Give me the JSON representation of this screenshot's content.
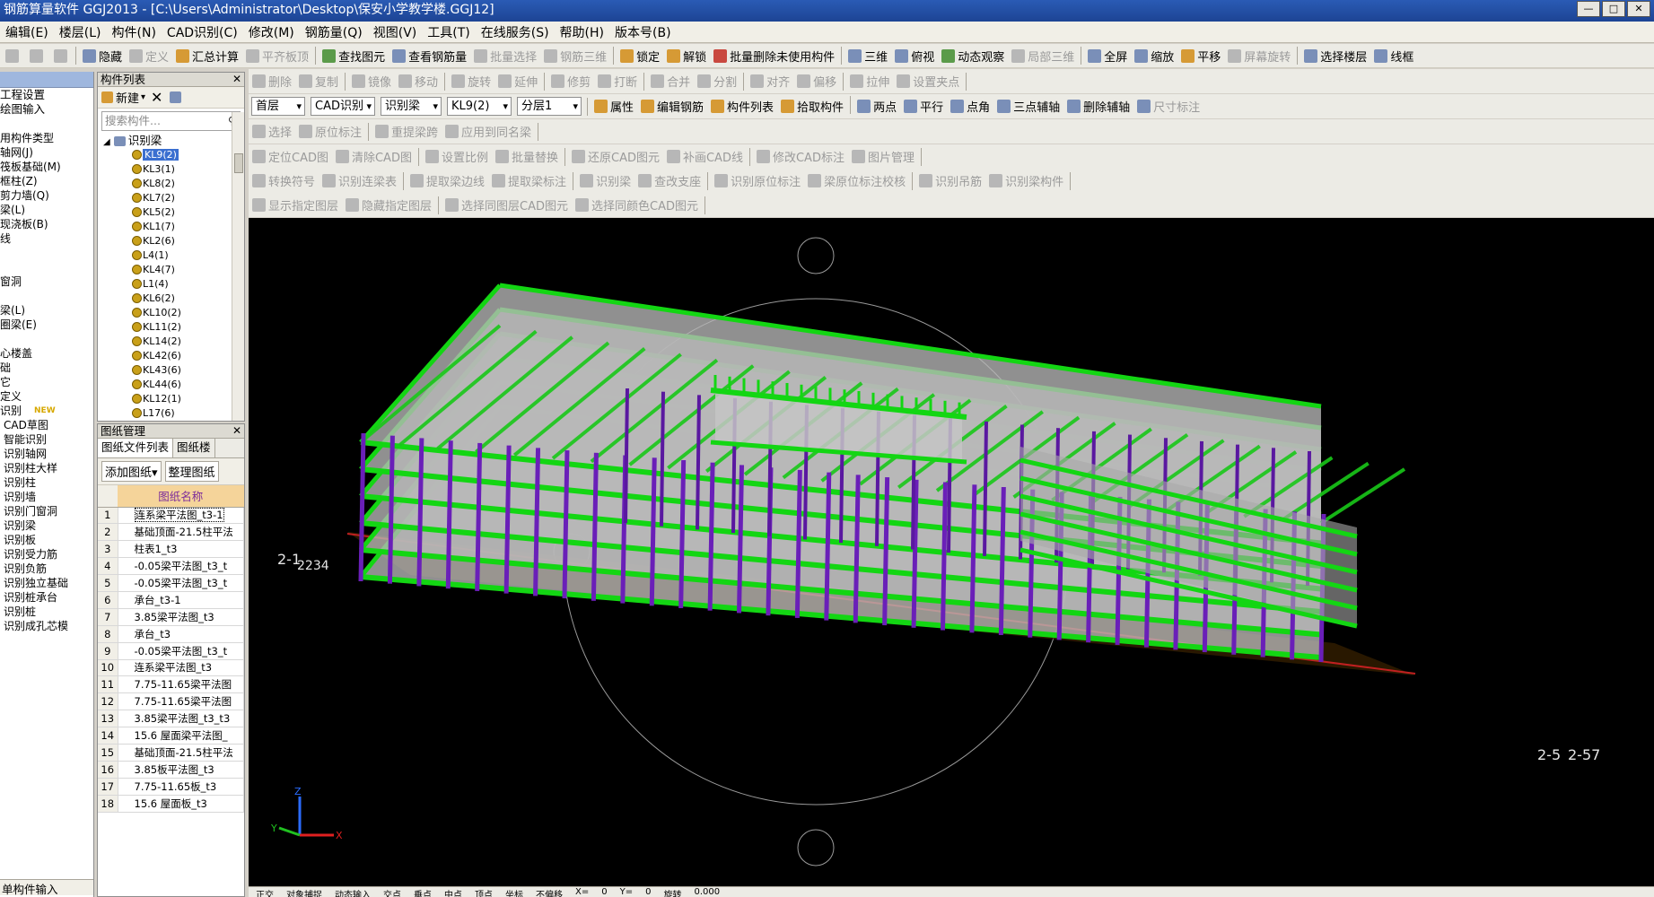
{
  "window": {
    "title": "钢筋算量软件 GGJ2013 - [C:\\Users\\Administrator\\Desktop\\保安小学教学楼.GGJ12]",
    "buttons": [
      "—",
      "□",
      "✕"
    ]
  },
  "menu": [
    "编辑(E)",
    "楼层(L)",
    "构件(N)",
    "CAD识别(C)",
    "修改(M)",
    "钢筋量(Q)",
    "视图(V)",
    "工具(T)",
    "在线服务(S)",
    "帮助(H)",
    "版本号(B)"
  ],
  "toolbar1": {
    "items": [
      {
        "label": "隐藏",
        "disabled": false
      },
      {
        "label": "定义",
        "disabled": true
      },
      {
        "label": "汇总计算",
        "disabled": false
      },
      {
        "label": "平齐板顶",
        "disabled": true
      },
      {
        "label": "查找图元",
        "disabled": false
      },
      {
        "label": "查看钢筋量",
        "disabled": false
      },
      {
        "label": "批量选择",
        "disabled": true
      },
      {
        "label": "钢筋三维",
        "disabled": true
      },
      {
        "label": "锁定",
        "disabled": false
      },
      {
        "label": "解锁",
        "disabled": false
      },
      {
        "label": "批量删除未使用构件",
        "disabled": false
      },
      {
        "label": "三维",
        "disabled": false
      },
      {
        "label": "俯视",
        "disabled": false
      },
      {
        "label": "动态观察",
        "disabled": false
      },
      {
        "label": "局部三维",
        "disabled": true
      },
      {
        "label": "全屏",
        "disabled": false
      },
      {
        "label": "缩放",
        "disabled": false
      },
      {
        "label": "平移",
        "disabled": false
      },
      {
        "label": "屏幕旋转",
        "disabled": true
      },
      {
        "label": "选择楼层",
        "disabled": false
      },
      {
        "label": "线框",
        "disabled": false
      }
    ]
  },
  "toolbar2": {
    "items": [
      "删除",
      "复制",
      "镜像",
      "移动",
      "旋转",
      "延伸",
      "修剪",
      "打断",
      "合并",
      "分割",
      "对齐",
      "偏移",
      "拉伸",
      "设置夹点"
    ]
  },
  "toolbar3": {
    "floor": "首层",
    "mode": "CAD识别",
    "type": "识别梁",
    "comp": "KL9(2)",
    "layer": "分层1",
    "items": [
      "属性",
      "编辑钢筋",
      "构件列表",
      "拾取构件",
      "两点",
      "平行",
      "点角",
      "三点辅轴",
      "删除辅轴",
      "尺寸标注"
    ]
  },
  "toolbar4": {
    "items": [
      "选择",
      "原位标注",
      "重提梁跨",
      "应用到同名梁"
    ]
  },
  "toolbar5": {
    "items": [
      "定位CAD图",
      "清除CAD图",
      "设置比例",
      "批量替换",
      "还原CAD图元",
      "补画CAD线",
      "修改CAD标注",
      "图片管理"
    ]
  },
  "toolbar6": {
    "items": [
      "转换符号",
      "识别连梁表",
      "提取梁边线",
      "提取梁标注",
      "识别梁",
      "查改支座",
      "识别原位标注",
      "梁原位标注校核",
      "识别吊筋",
      "识别梁构件"
    ]
  },
  "toolbar7": {
    "items": [
      "显示指定图层",
      "隐藏指定图层",
      "选择同图层CAD图元",
      "选择同颜色CAD图元"
    ]
  },
  "leftNav": {
    "header": "",
    "items": [
      "工程设置",
      "绘图输入",
      "",
      "用构件类型",
      "轴网(J)",
      "筏板基础(M)",
      "框柱(Z)",
      "剪力墙(Q)",
      "梁(L)",
      "现浇板(B)",
      "线",
      "",
      "",
      "窗洞",
      "",
      "梁(L)",
      "圈梁(E)",
      "",
      "心楼盖",
      "础",
      "它",
      "定义",
      "识别",
      "CAD草图",
      "智能识别",
      "识别轴网",
      "识别柱大样",
      "识别柱",
      "识别墙",
      "识别门窗洞",
      "识别梁",
      "识别板",
      "识别受力筋",
      "识别负筋",
      "识别独立基础",
      "识别桩承台",
      "识别桩",
      "识别成孔芯模"
    ],
    "newBadge": "NEW",
    "footer": "单构件输入"
  },
  "componentList": {
    "title": "构件列表",
    "newLabel": "新建",
    "searchPlaceholder": "搜索构件...",
    "root": "识别梁",
    "items": [
      "KL9(2)",
      "KL3(1)",
      "KL8(2)",
      "KL7(2)",
      "KL5(2)",
      "KL1(7)",
      "KL2(6)",
      "L4(1)",
      "KL4(7)",
      "L1(4)",
      "KL6(2)",
      "KL10(2)",
      "KL11(2)",
      "KL14(2)",
      "KL42(6)",
      "KL43(6)",
      "KL44(6)",
      "KL12(1)",
      "L17(6)"
    ]
  },
  "drawingPanel": {
    "title": "图纸管理",
    "tabs": [
      "图纸文件列表",
      "图纸楼"
    ],
    "addLabel": "添加图纸",
    "organizeLabel": "整理图纸",
    "colHeader": "图纸名称",
    "rows": [
      "连系梁平法图_t3-1",
      "基础顶面-21.5柱平法",
      "柱表1_t3",
      "-0.05梁平法图_t3_t",
      "-0.05梁平法图_t3_t",
      "承台_t3-1",
      "3.85梁平法图_t3",
      "承台_t3",
      "-0.05梁平法图_t3_t",
      "连系梁平法图_t3",
      "7.75-11.65梁平法图",
      "7.75-11.65梁平法图",
      "3.85梁平法图_t3_t3",
      "15.6 屋面梁平法图_",
      "基础顶面-21.5柱平法",
      "3.85板平法图_t3",
      "7.75-11.65板_t3",
      "15.6 屋面板_t3"
    ]
  },
  "canvas": {
    "axisLabelLeft": "2-1",
    "axisLabelLeft2": "2234",
    "axisLabelRight": "2-5",
    "axisLabelRight2": "2-57",
    "axes": {
      "z": "Z",
      "x": "X",
      "y": "Y"
    }
  },
  "statusbar": [
    "正交",
    "对象捕捉",
    "动态输入",
    "交点",
    "垂点",
    "中点",
    "顶点",
    "坐标",
    "不偏移",
    "X=",
    "0",
    "Y=",
    "0",
    "旋转",
    "0.000"
  ]
}
